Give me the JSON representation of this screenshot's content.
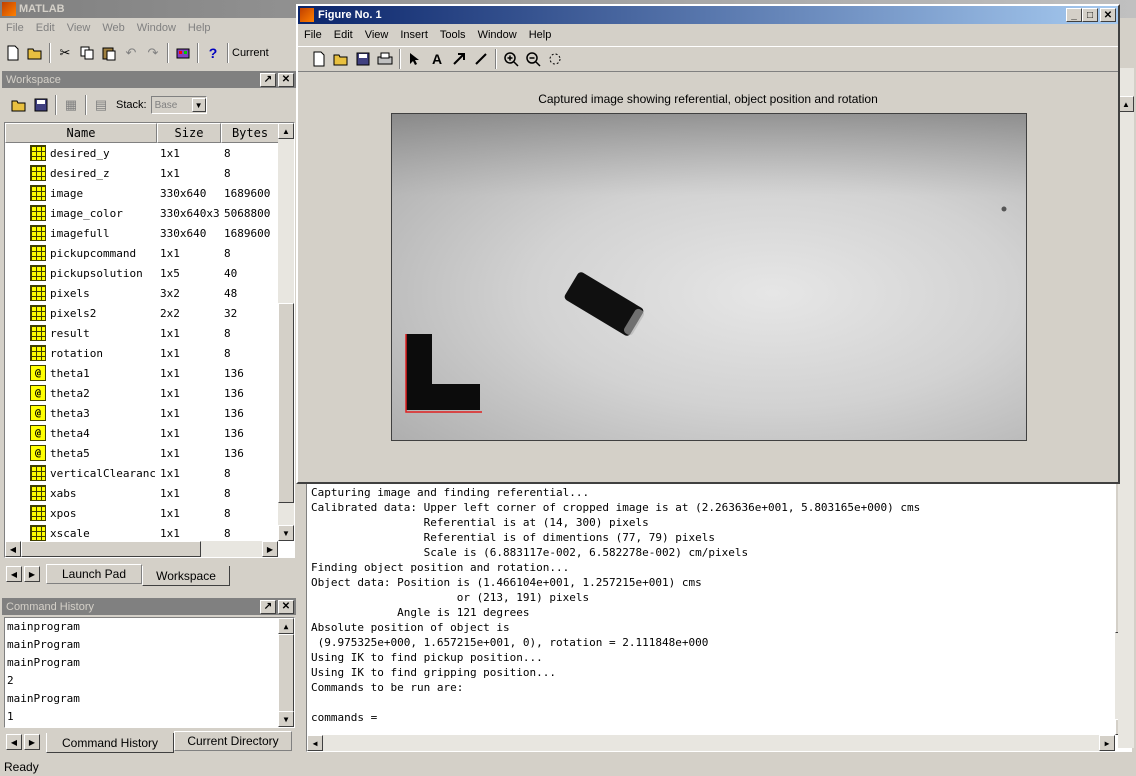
{
  "app": {
    "title": "MATLAB",
    "menu": [
      "File",
      "Edit",
      "View",
      "Web",
      "Window",
      "Help"
    ],
    "current_dir_label": "Current",
    "status": "Ready"
  },
  "workspace": {
    "title": "Workspace",
    "stack_label": "Stack:",
    "stack_value": "Base",
    "columns": [
      "Name",
      "Size",
      "Bytes"
    ],
    "rows": [
      {
        "name": "desired_y",
        "size": "1x1",
        "bytes": "8",
        "icon": "grid"
      },
      {
        "name": "desired_z",
        "size": "1x1",
        "bytes": "8",
        "icon": "grid"
      },
      {
        "name": "image",
        "size": "330x640",
        "bytes": "1689600",
        "icon": "grid"
      },
      {
        "name": "image_color",
        "size": "330x640x3",
        "bytes": "5068800",
        "icon": "grid"
      },
      {
        "name": "imagefull",
        "size": "330x640",
        "bytes": "1689600",
        "icon": "grid"
      },
      {
        "name": "pickupcommand",
        "size": "1x1",
        "bytes": "8",
        "icon": "grid"
      },
      {
        "name": "pickupsolution",
        "size": "1x5",
        "bytes": "40",
        "icon": "grid"
      },
      {
        "name": "pixels",
        "size": "3x2",
        "bytes": "48",
        "icon": "grid"
      },
      {
        "name": "pixels2",
        "size": "2x2",
        "bytes": "32",
        "icon": "grid"
      },
      {
        "name": "result",
        "size": "1x1",
        "bytes": "8",
        "icon": "grid"
      },
      {
        "name": "rotation",
        "size": "1x1",
        "bytes": "8",
        "icon": "grid"
      },
      {
        "name": "theta1",
        "size": "1x1",
        "bytes": "136",
        "icon": "cell"
      },
      {
        "name": "theta2",
        "size": "1x1",
        "bytes": "136",
        "icon": "cell"
      },
      {
        "name": "theta3",
        "size": "1x1",
        "bytes": "136",
        "icon": "cell"
      },
      {
        "name": "theta4",
        "size": "1x1",
        "bytes": "136",
        "icon": "cell"
      },
      {
        "name": "theta5",
        "size": "1x1",
        "bytes": "136",
        "icon": "cell"
      },
      {
        "name": "verticalClearance",
        "size": "1x1",
        "bytes": "8",
        "icon": "grid"
      },
      {
        "name": "xabs",
        "size": "1x1",
        "bytes": "8",
        "icon": "grid"
      },
      {
        "name": "xpos",
        "size": "1x1",
        "bytes": "8",
        "icon": "grid"
      },
      {
        "name": "xscale",
        "size": "1x1",
        "bytes": "8",
        "icon": "grid"
      }
    ],
    "tabs": [
      "Launch Pad",
      "Workspace"
    ]
  },
  "history": {
    "title": "Command History",
    "lines": [
      "mainprogram",
      "mainProgram",
      "mainProgram",
      "2",
      "mainProgram",
      "1"
    ],
    "tabs": [
      "Command History",
      "Current Directory"
    ]
  },
  "figure": {
    "title": "Figure No. 1",
    "menu": [
      "File",
      "Edit",
      "View",
      "Insert",
      "Tools",
      "Window",
      "Help"
    ],
    "plot_title": "Captured image showing referential, object position and rotation"
  },
  "command_window": {
    "lines": [
      "Capturing image and finding referential...",
      "Calibrated data: Upper left corner of cropped image is at (2.263636e+001, 5.803165e+000) cms",
      "                 Referential is at (14, 300) pixels",
      "                 Referential is of dimentions (77, 79) pixels",
      "                 Scale is (6.883117e-002, 6.582278e-002) cm/pixels",
      "Finding object position and rotation...",
      "Object data: Position is (1.466104e+001, 1.257215e+001) cms",
      "                      or (213, 191) pixels",
      "             Angle is 121 degrees",
      "Absolute position of object is",
      " (9.975325e+000, 1.657215e+001, 0), rotation = 2.111848e+000",
      "Using IK to find pickup position...",
      "Using IK to find gripping position...",
      "Commands to be run are:",
      "",
      "commands ="
    ]
  }
}
